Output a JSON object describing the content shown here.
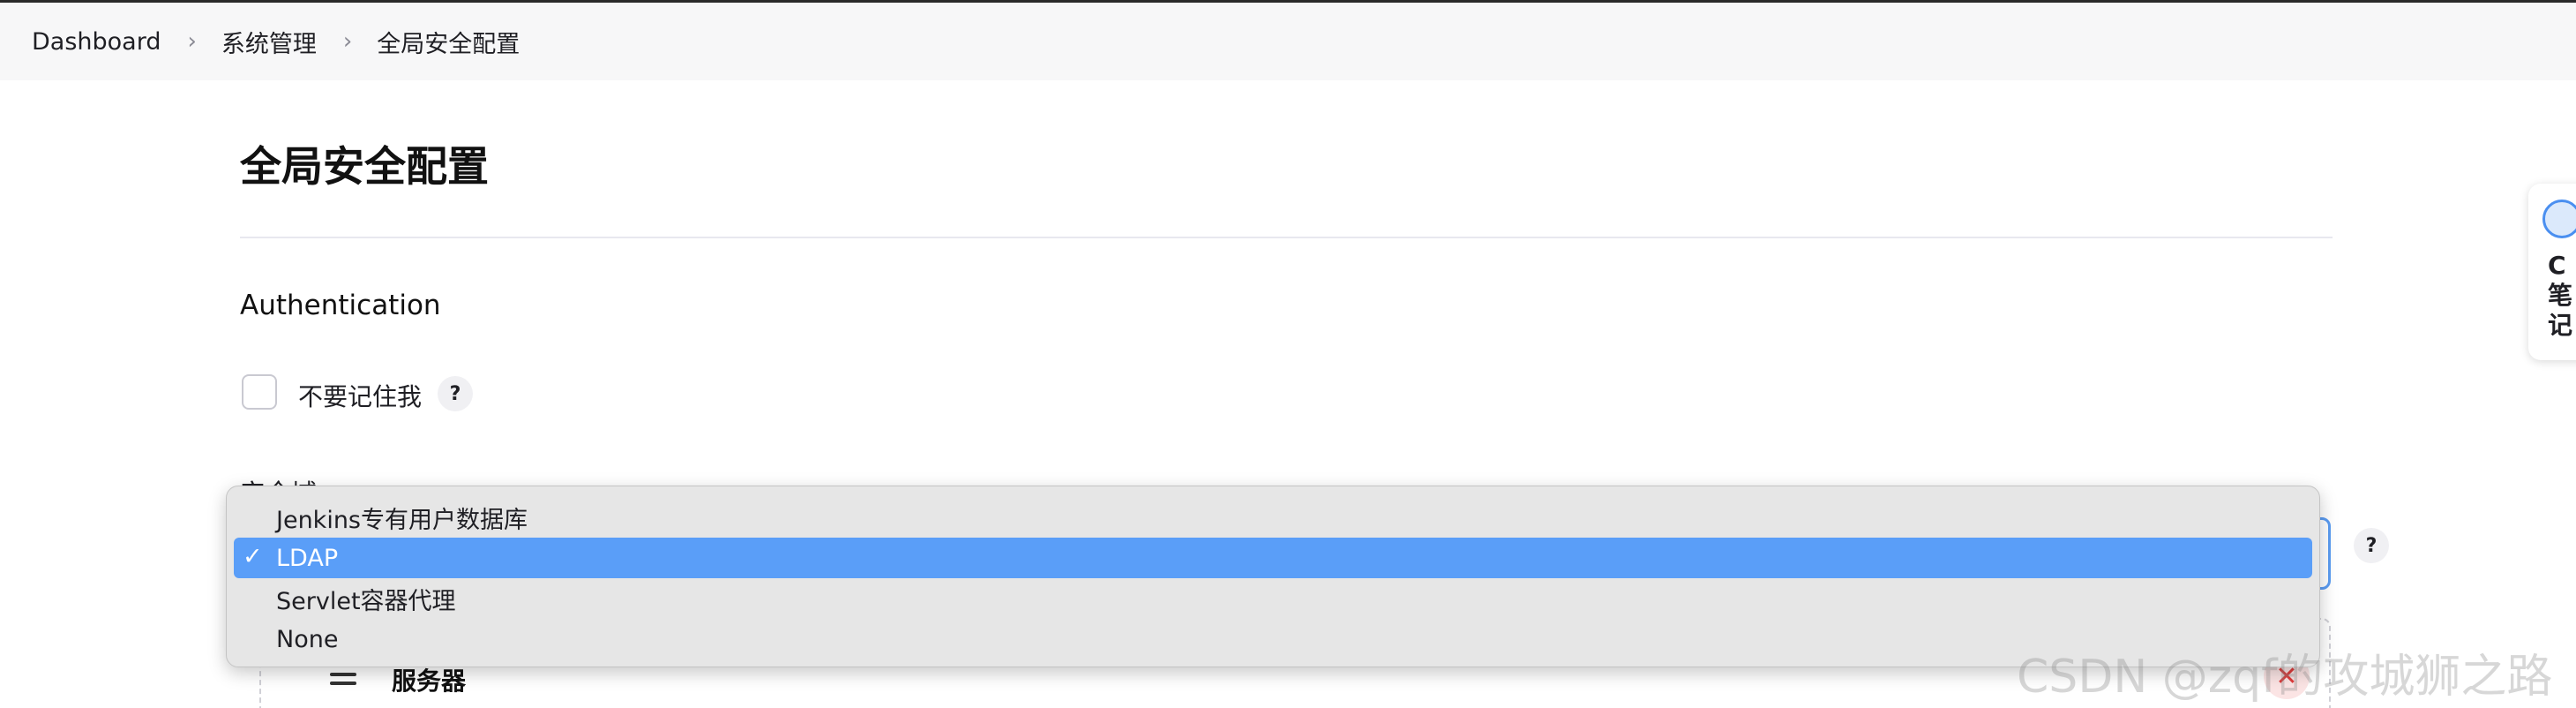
{
  "breadcrumb": {
    "items": [
      "Dashboard",
      "系统管理",
      "全局安全配置"
    ],
    "separator": "›"
  },
  "page": {
    "title": "全局安全配置"
  },
  "authentication": {
    "section_title": "Authentication",
    "remember_me_label": "不要记住我",
    "remember_me_checked": false,
    "help_label": "?"
  },
  "security_realm": {
    "label": "安全域",
    "selected": "LDAP",
    "options": [
      "Jenkins专有用户数据库",
      "LDAP",
      "Servlet容器代理",
      "None"
    ],
    "check_glyph": "✓",
    "help_label": "?"
  },
  "server_card": {
    "title": "服务器",
    "delete_glyph": "✕"
  },
  "side_widget": {
    "text": "C\n笔\n记"
  },
  "watermark": "CSDN @zqf的攻城狮之路",
  "colors": {
    "accent": "#5a9ef8",
    "focus_border": "#5b9cf2",
    "delete": "#e03b3b"
  }
}
